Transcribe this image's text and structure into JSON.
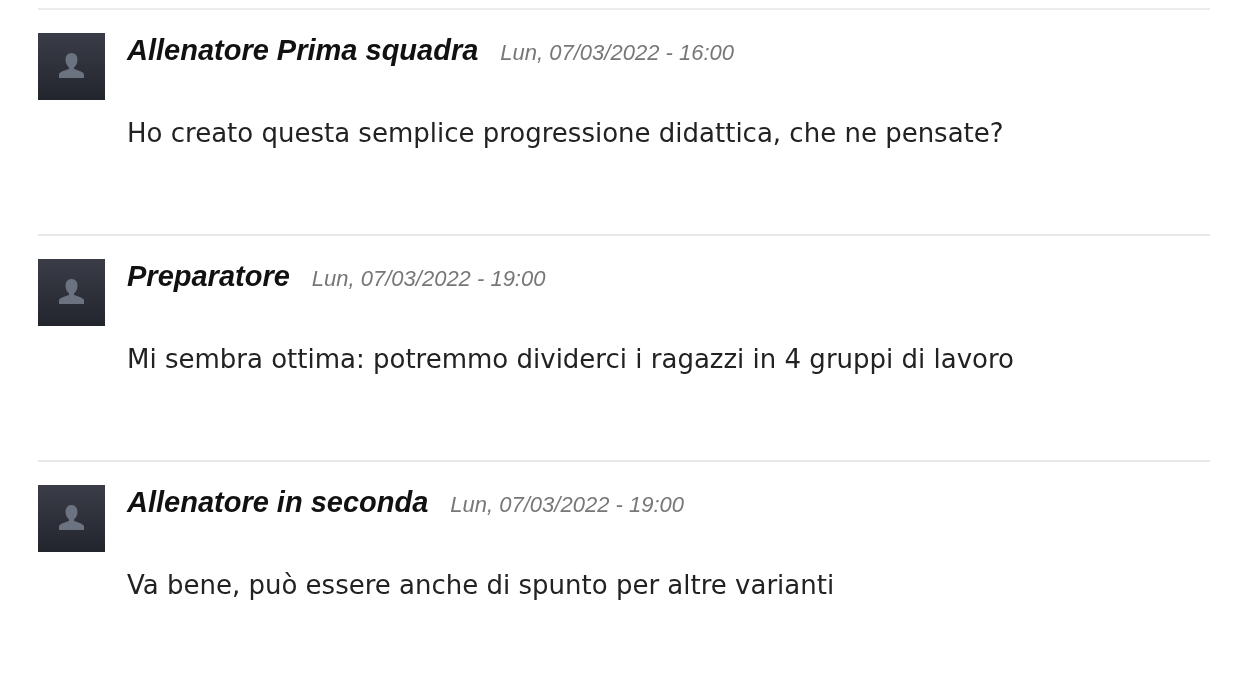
{
  "comments": [
    {
      "author": "Allenatore Prima squadra",
      "date": "Lun, 07/03/2022 - 16:00",
      "text": "Ho creato questa semplice progressione didattica, che ne pensate?"
    },
    {
      "author": "Preparatore",
      "date": "Lun, 07/03/2022 - 19:00",
      "text": "Mi sembra ottima: potremmo dividerci i ragazzi in 4 gruppi di lavoro"
    },
    {
      "author": "Allenatore in seconda",
      "date": "Lun, 07/03/2022 - 19:00",
      "text": "Va bene, può essere anche di spunto per altre varianti"
    }
  ]
}
